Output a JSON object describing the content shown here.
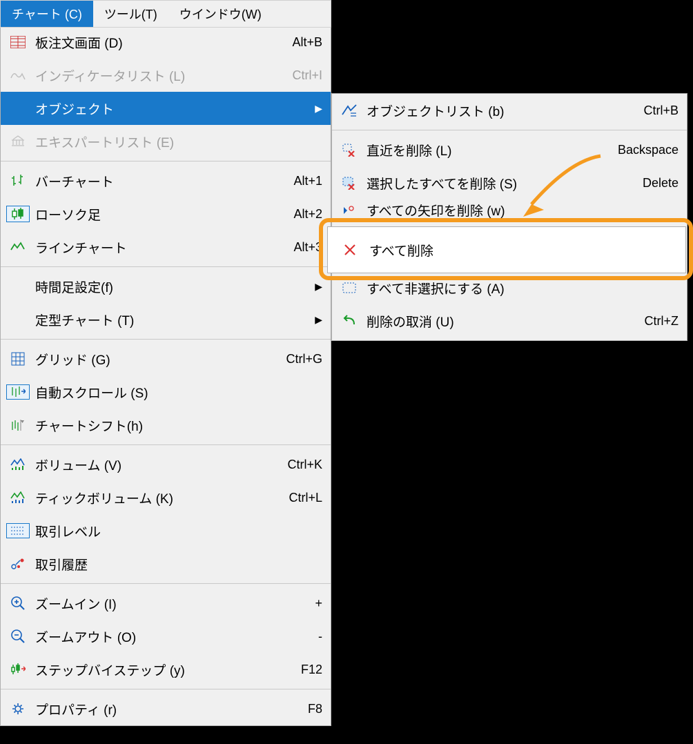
{
  "menubar": {
    "chart": "チャート (C)",
    "tools": "ツール(T)",
    "window": "ウインドウ(W)"
  },
  "dropdown": {
    "order_screen": {
      "label": "板注文画面 (D)",
      "shortcut": "Alt+B"
    },
    "indicator_list": {
      "label": "インディケータリスト (L)",
      "shortcut": "Ctrl+I"
    },
    "objects": {
      "label": "オブジェクト"
    },
    "expert_list": {
      "label": "エキスパートリスト (E)"
    },
    "bar_chart": {
      "label": "バーチャート",
      "shortcut": "Alt+1"
    },
    "candlestick": {
      "label": "ローソク足",
      "shortcut": "Alt+2"
    },
    "line_chart": {
      "label": "ラインチャート",
      "shortcut": "Alt+3"
    },
    "timeframe": {
      "label": "時間足設定(f)"
    },
    "template": {
      "label": "定型チャート (T)"
    },
    "grid": {
      "label": "グリッド (G)",
      "shortcut": "Ctrl+G"
    },
    "auto_scroll": {
      "label": "自動スクロール (S)"
    },
    "chart_shift": {
      "label": "チャートシフト(h)"
    },
    "volume": {
      "label": "ボリューム (V)",
      "shortcut": "Ctrl+K"
    },
    "tick_volume": {
      "label": "ティックボリューム (K)",
      "shortcut": "Ctrl+L"
    },
    "trade_level": {
      "label": "取引レベル"
    },
    "trade_history": {
      "label": "取引履歴"
    },
    "zoom_in": {
      "label": "ズームイン (I)",
      "shortcut": "+"
    },
    "zoom_out": {
      "label": "ズームアウト (O)",
      "shortcut": "-"
    },
    "step_by_step": {
      "label": "ステップバイステップ (y)",
      "shortcut": "F12"
    },
    "properties": {
      "label": "プロパティ (r)",
      "shortcut": "F8"
    }
  },
  "submenu": {
    "object_list": {
      "label": "オブジェクトリスト (b)",
      "shortcut": "Ctrl+B"
    },
    "delete_recent": {
      "label": "直近を削除 (L)",
      "shortcut": "Backspace"
    },
    "delete_selected": {
      "label": "選択したすべてを削除 (S)",
      "shortcut": "Delete"
    },
    "delete_arrows": {
      "label": "すべての矢印を削除 (w)"
    },
    "delete_all": {
      "label": "すべて削除"
    },
    "deselect_all": {
      "label": "すべて非選択にする (A)"
    },
    "undo_delete": {
      "label": "削除の取消 (U)",
      "shortcut": "Ctrl+Z"
    }
  }
}
